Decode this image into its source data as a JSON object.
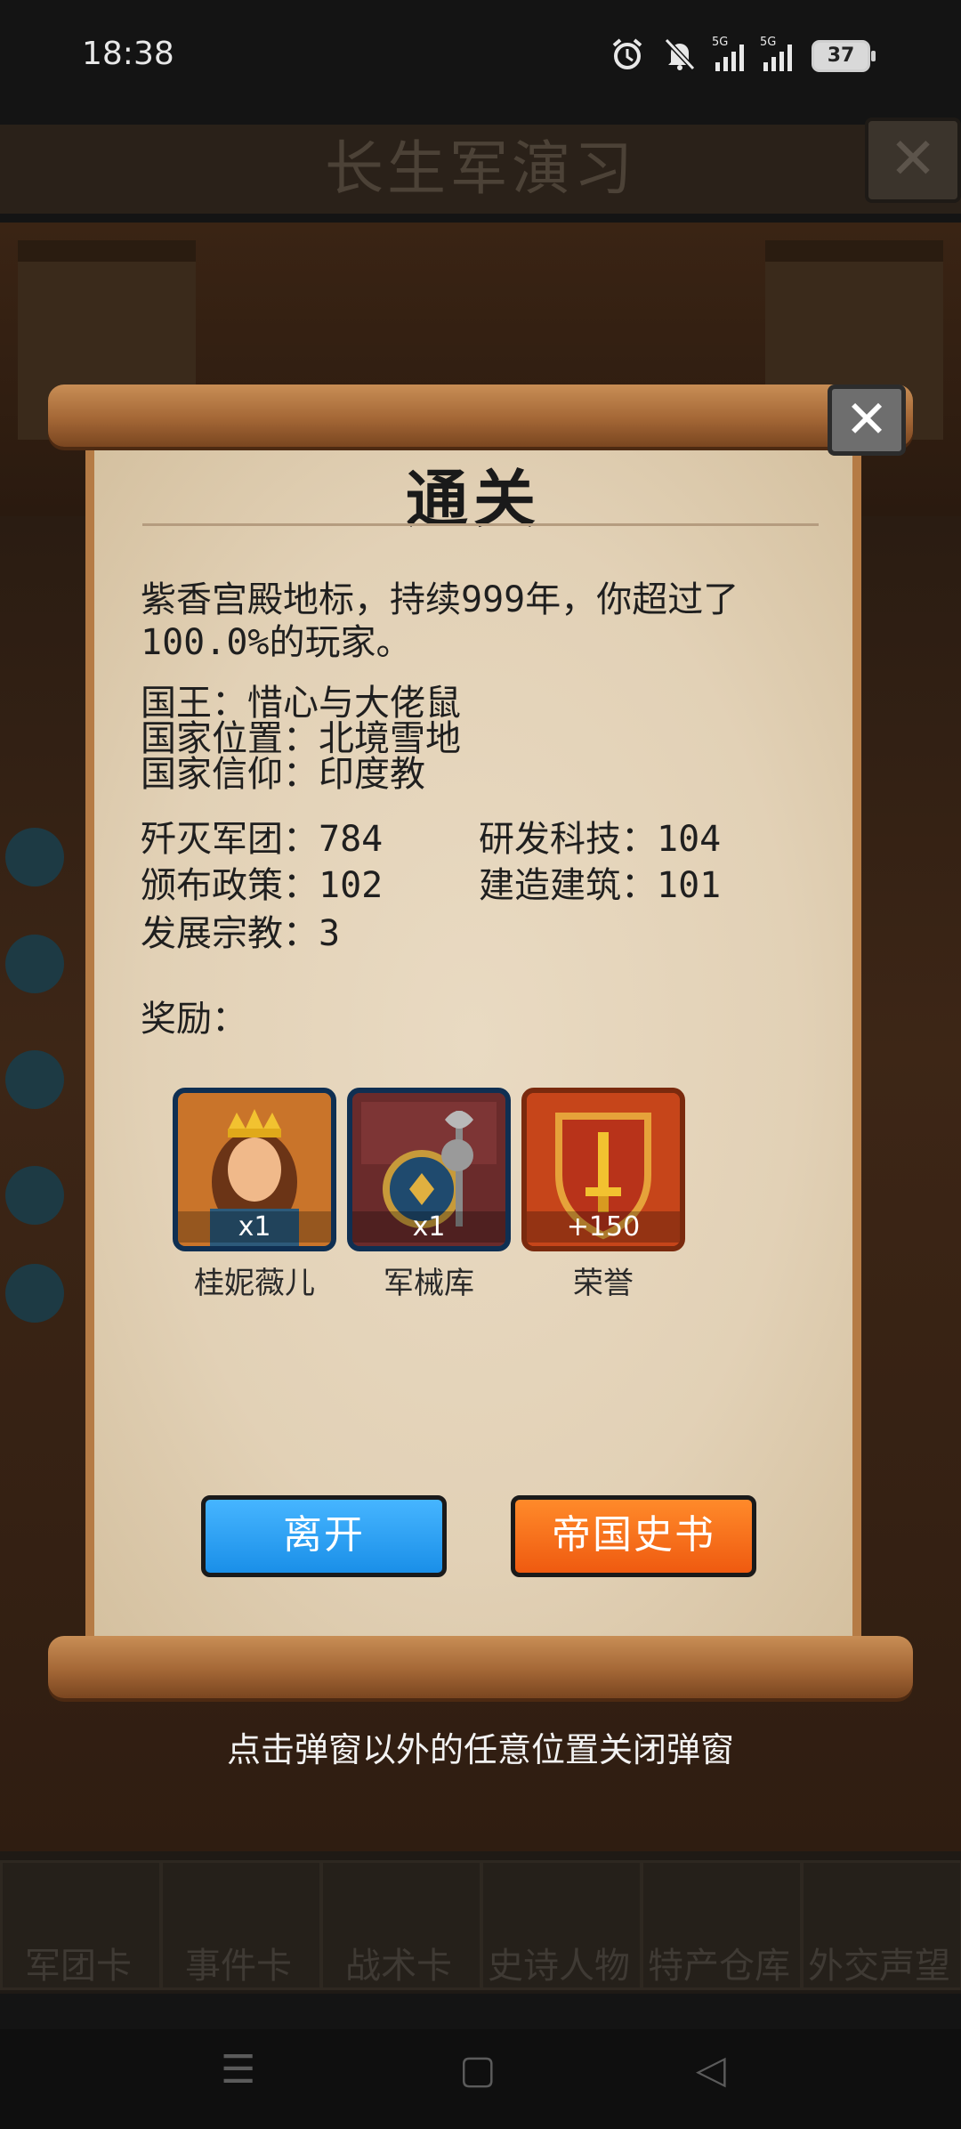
{
  "status_bar": {
    "time": "18:38",
    "signal_1": "5G",
    "signal_2": "5G",
    "battery": "37"
  },
  "background": {
    "title": "长生军演习",
    "dock": [
      "军团卡",
      "事件卡",
      "战术卡",
      "史诗人物",
      "特产仓库",
      "外交声望"
    ]
  },
  "dialog": {
    "title": "通关",
    "summary_line1": "紫香宫殿地标，持续999年，你超过了",
    "summary_line2": "100.0%的玩家。",
    "king": "国王：惜心与大佬鼠",
    "location": "国家位置：北境雪地",
    "religion": "国家信仰：印度教",
    "stats": {
      "legions": "歼灭军团：784",
      "tech": "研发科技：104",
      "policy": "颁布政策：102",
      "buildings": "建造建筑：101",
      "religion_dev": "发展宗教：3"
    },
    "rewards_label": "奖励：",
    "rewards": [
      {
        "name": "桂妮薇儿",
        "count": "x1",
        "icon": "queen-portrait-icon"
      },
      {
        "name": "军械库",
        "count": "x1",
        "icon": "armory-icon"
      },
      {
        "name": "荣誉",
        "count": "+150",
        "icon": "honor-shield-icon"
      }
    ],
    "leave_button": "离开",
    "history_button": "帝国史书"
  },
  "hint": "点击弹窗以外的任意位置关闭弹窗",
  "colors": {
    "leave_button": "#1a8fe8",
    "history_button": "#ef5a10",
    "paper": "#e4d4ba"
  }
}
